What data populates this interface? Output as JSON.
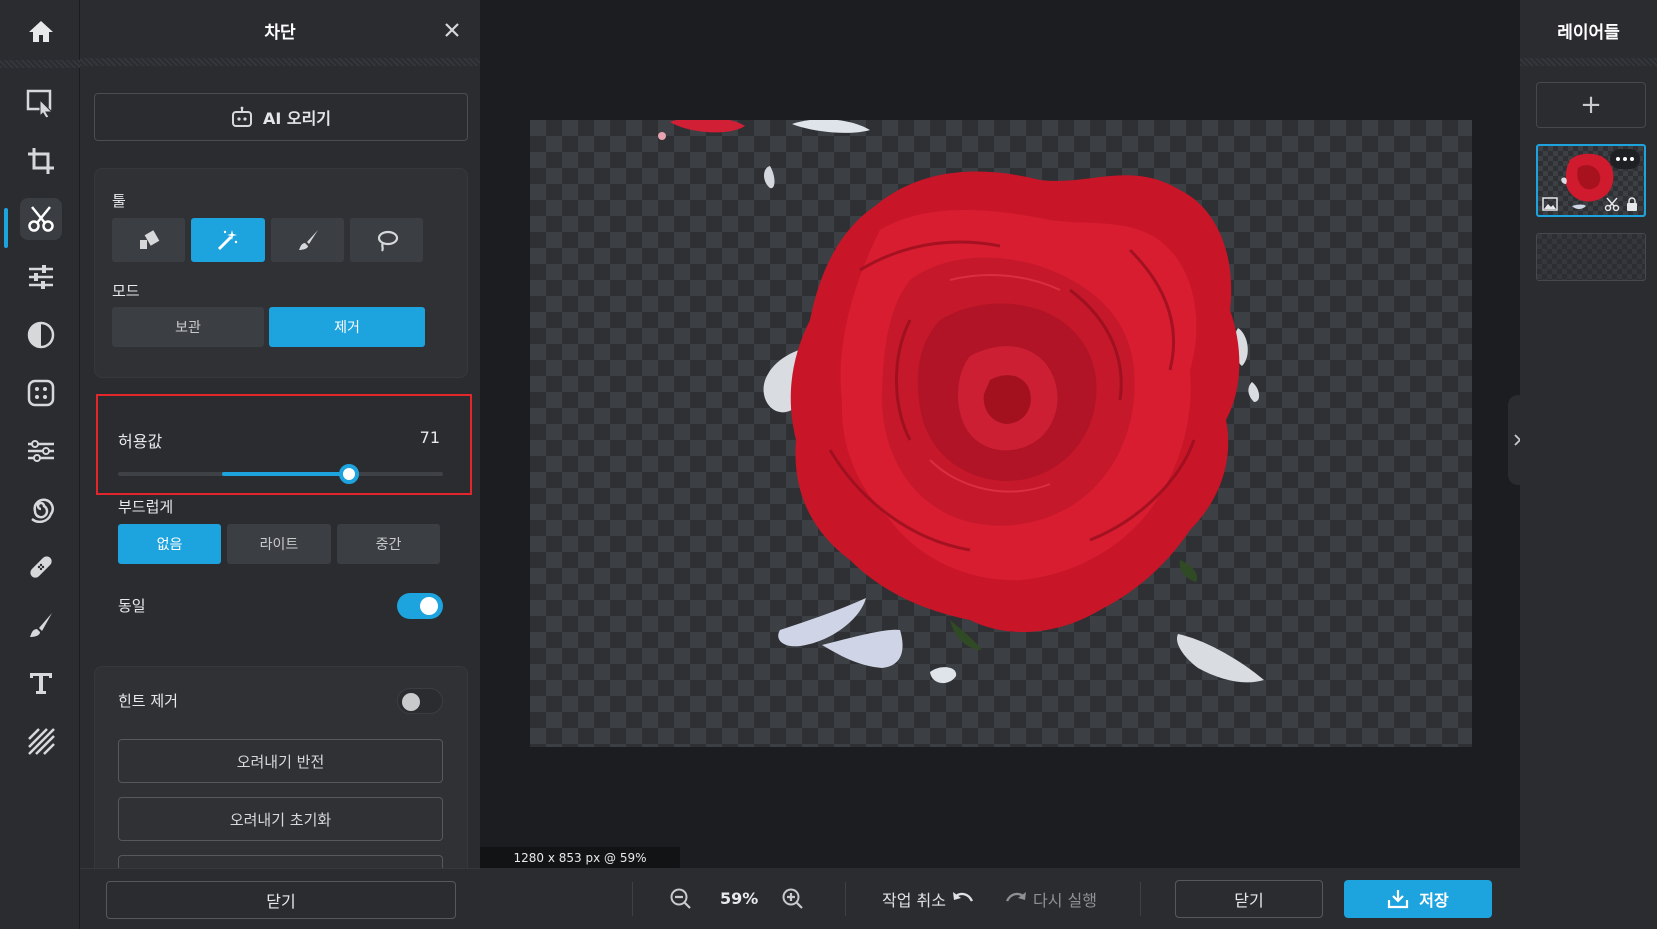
{
  "panel": {
    "title": "차단",
    "ai_button": "AI 오리기",
    "tools_label": "툴",
    "tools": [
      {
        "icon": "eraser-icon",
        "active": false
      },
      {
        "icon": "magic-wand-icon",
        "active": true
      },
      {
        "icon": "brush-icon",
        "active": false
      },
      {
        "icon": "lasso-icon",
        "active": false
      }
    ],
    "mode_label": "모드",
    "mode_options": [
      "보관",
      "제거"
    ],
    "mode_selected": "제거",
    "tolerance_label": "허용값",
    "tolerance_value": "71",
    "tolerance_fraction": 0.71,
    "smooth_label": "부드럽게",
    "smooth_options": [
      "없음",
      "라이트",
      "중간"
    ],
    "smooth_selected": "없음",
    "contiguous_label": "동일",
    "contiguous_on": true,
    "defringe_label": "힌트 제거",
    "defringe_on": false,
    "invert_button": "오려내기 반전",
    "reset_button": "오려내기 초기화",
    "close_button": "닫기"
  },
  "canvas": {
    "dimensions_text": "1280 x 853 px @ 59%"
  },
  "bottombar": {
    "zoom": "59%",
    "undo": "작업 취소",
    "redo": "다시 실행",
    "close": "닫기",
    "save": "저장"
  },
  "layers": {
    "title": "레이어들",
    "add": "+"
  },
  "colors": {
    "accent": "#1da3de",
    "highlight_box": "#e3262c",
    "panel_bg": "#2a2c30",
    "canvas_bg": "#1c1d20"
  }
}
